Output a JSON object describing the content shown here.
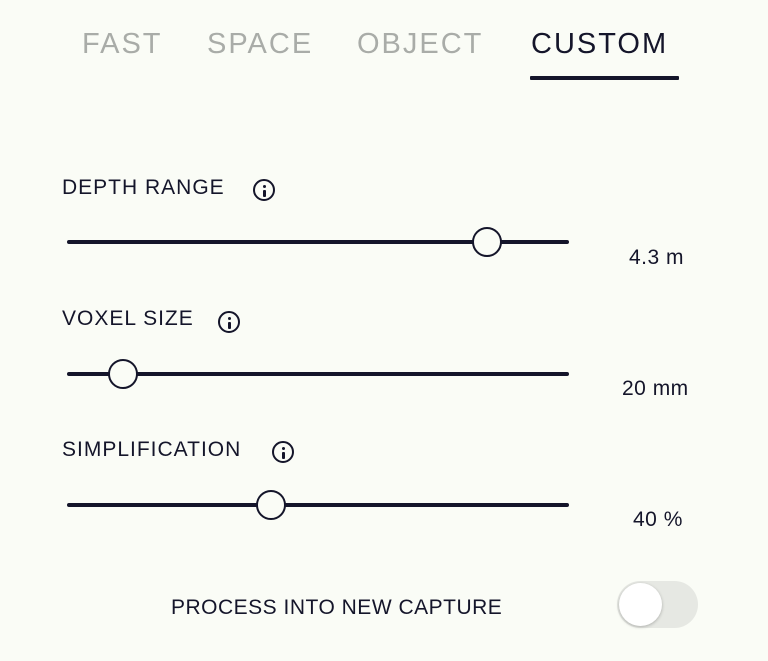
{
  "tabs": [
    {
      "label": "FAST",
      "active": false
    },
    {
      "label": "SPACE",
      "active": false
    },
    {
      "label": "OBJECT",
      "active": false
    },
    {
      "label": "CUSTOM",
      "active": true
    }
  ],
  "settings": [
    {
      "label": "DEPTH RANGE",
      "value_text": "4.3 m",
      "slider_fraction": 0.836
    },
    {
      "label": "VOXEL SIZE",
      "value_text": "20 mm",
      "slider_fraction": 0.112
    },
    {
      "label": "SIMPLIFICATION",
      "value_text": "40 %",
      "slider_fraction": 0.406
    }
  ],
  "process": {
    "label": "PROCESS INTO NEW CAPTURE",
    "enabled": false
  },
  "colors": {
    "foreground": "#14152a",
    "inactive_tab": "#a9aca8",
    "background": "#fafcf6",
    "toggle_off": "#e6e8e3"
  }
}
